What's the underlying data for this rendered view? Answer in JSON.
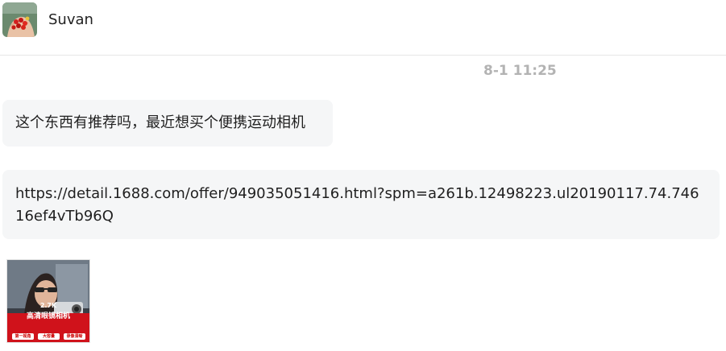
{
  "header": {
    "contact_name": "Suvan",
    "avatar_icon": "avatar-red-berries-in-hand"
  },
  "chat": {
    "timestamp": "8-1 11:25",
    "messages": [
      {
        "text": "这个东西有推荐吗，最近想买个便携运动相机"
      },
      {
        "text": "https://detail.1688.com/offer/949035051416.html?spm=a261b.12498223.ul20190117.74.74616ef4vTb96Q"
      }
    ],
    "product_image": {
      "resolution_label": "2.7K",
      "title_label": "高清眼镜相机",
      "badges": [
        "第一视角",
        "大容量",
        "录像清晰"
      ]
    }
  },
  "colors": {
    "bubble_bg": "#f5f6f7",
    "timestamp": "#b3b3b3",
    "product_red": "#d0121b"
  }
}
